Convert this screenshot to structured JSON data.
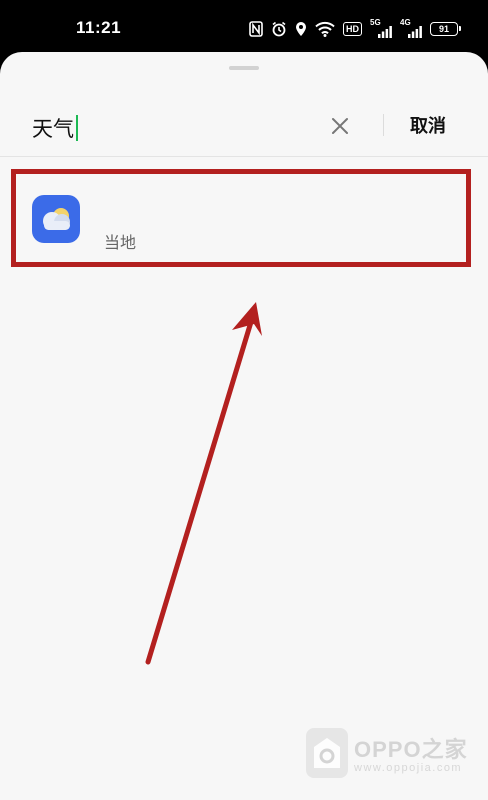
{
  "status_bar": {
    "time": "11:21",
    "hd_label": "HD",
    "net1_label": "5G",
    "net2_label": "4G",
    "battery_level": "91"
  },
  "search": {
    "query": "天气",
    "cancel_label": "取消"
  },
  "results": [
    {
      "app_name": "",
      "subtitle": "当地",
      "icon": "weather-cloud-sun-icon"
    }
  ],
  "watermark": {
    "title": "OPPO之家",
    "url": "www.oppojia.com"
  },
  "colors": {
    "highlight": "#b3201f",
    "app_icon_bg": "#3b6be8",
    "caret": "#1db954"
  }
}
